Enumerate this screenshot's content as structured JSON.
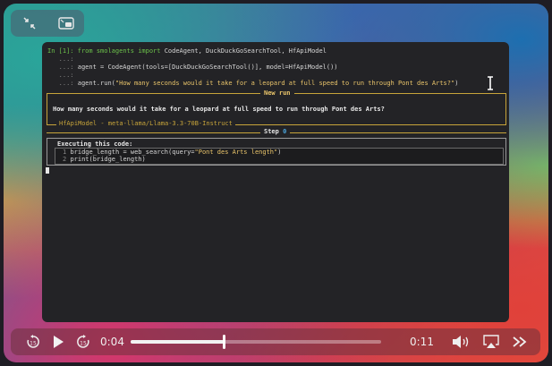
{
  "window": {
    "top_controls": [
      {
        "icon": "collapse-arrows-icon"
      },
      {
        "icon": "picture-in-picture-icon"
      }
    ]
  },
  "terminal": {
    "prompt_in": "In [1]:",
    "line1_from": "from",
    "line1_module": "smolagents",
    "line1_import": "import",
    "line1_rest": "CodeAgent, DuckDuckGoSearchTool, HfApiModel",
    "cont": "...:",
    "line4": "agent = CodeAgent(tools=[DuckDuckGoSearchTool()], model=HfApiModel())",
    "line6_pre": "agent.run(",
    "line6_str": "\"How many seconds would it take for a leopard at full speed to run through Pont des Arts?\"",
    "line6_post": ")",
    "new_run_title": "New run",
    "new_run_text": "How many seconds would it take for a leopard at full speed to run through Pont des Arts?",
    "model_label": "HfApiModel - meta-llama/Llama-3.3-70B-Instruct",
    "step_label": "Step",
    "step_number": "0",
    "executing_label": "Executing this code:",
    "code": [
      {
        "num": "1",
        "pre": "bridge_length = web_search(query=",
        "str": "\"Pont des Arts length\"",
        "post": ")"
      },
      {
        "num": "2",
        "pre": "print(bridge_length)",
        "str": "",
        "post": ""
      }
    ]
  },
  "player": {
    "current_time": "0:04",
    "remaining_time": "0:11",
    "progress": 0.37,
    "icons": {
      "rewind": "rewind-15-icon",
      "play": "play-icon",
      "forward": "forward-15-icon",
      "volume": "volume-icon",
      "airplay": "airplay-icon",
      "speed": "fast-forward-icon"
    },
    "skip_amount": "15"
  },
  "colors": {
    "terminal_bg": "#232326",
    "accent_yellow": "#e9c46a",
    "green": "#6cc24a"
  }
}
